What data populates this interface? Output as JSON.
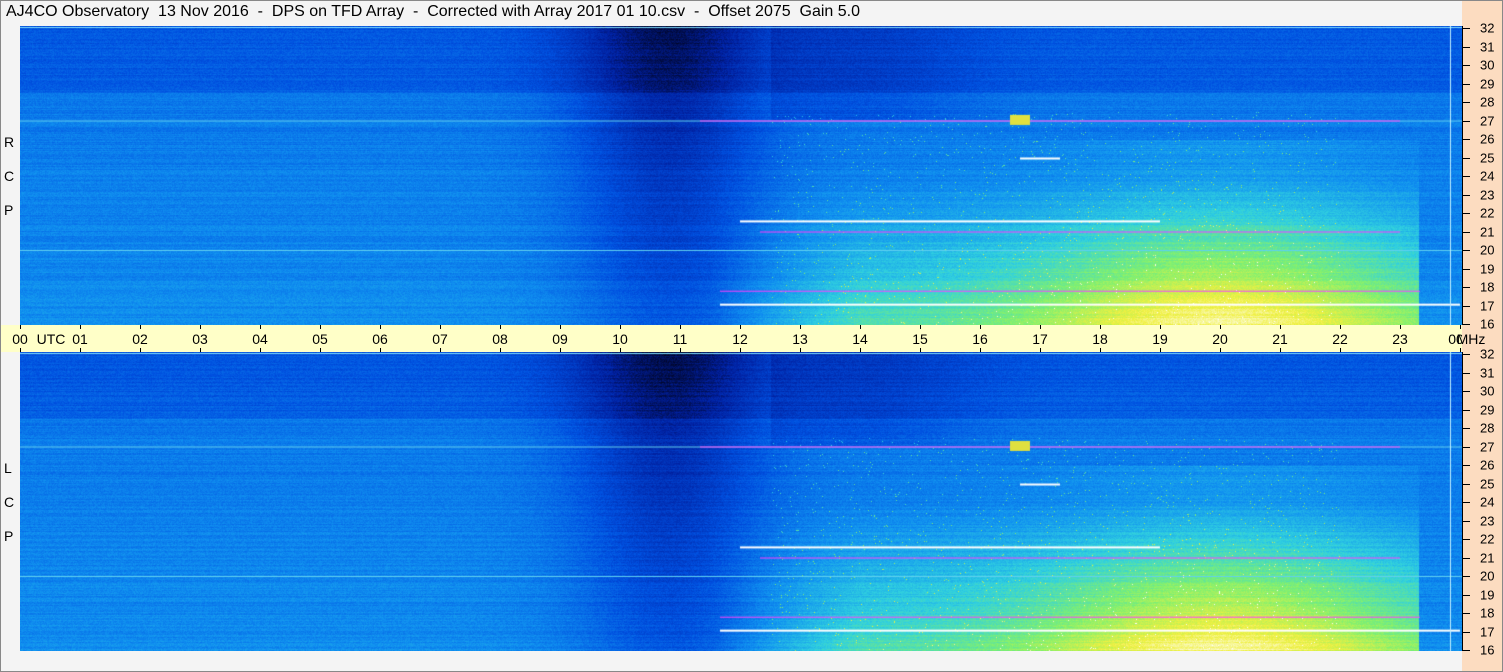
{
  "title": "AJ4CO Observatory  13 Nov 2016  -  DPS on TFD Array  -  Corrected with Array 2017 01 10.csv  -  Offset 2075  Gain 5.0",
  "chart_data": {
    "type": "heatmap",
    "panels": [
      {
        "label": [
          "R",
          "C",
          "P"
        ],
        "name": "RCP"
      },
      {
        "label": [
          "L",
          "C",
          "P"
        ],
        "name": "LCP"
      }
    ],
    "x_axis": {
      "unit_left": "UTC",
      "ticks": [
        "00",
        "01",
        "02",
        "03",
        "04",
        "05",
        "06",
        "07",
        "08",
        "09",
        "10",
        "11",
        "12",
        "13",
        "14",
        "15",
        "16",
        "17",
        "18",
        "19",
        "20",
        "21",
        "22",
        "23",
        "00"
      ],
      "range_hours": [
        0,
        24
      ]
    },
    "y_axis": {
      "unit": "MHz",
      "ticks": [
        32,
        31,
        30,
        29,
        28,
        27,
        26,
        25,
        24,
        23,
        22,
        21,
        20,
        19,
        18,
        17,
        16
      ],
      "range": [
        16,
        32
      ]
    },
    "colormap": [
      "#000010",
      "#0020a0",
      "#0050e0",
      "#1090f0",
      "#30d0e0",
      "#80f070",
      "#f0f040",
      "#ffffff"
    ],
    "features": {
      "quiet_background_hours": [
        0,
        9
      ],
      "dark_dip_hours": [
        9,
        12.5
      ],
      "activity_onset_hour": 11.5,
      "strong_emission_band_mhz": [
        16,
        22
      ],
      "rfi_lines_mhz": [
        27,
        20,
        22,
        21,
        17
      ]
    }
  }
}
